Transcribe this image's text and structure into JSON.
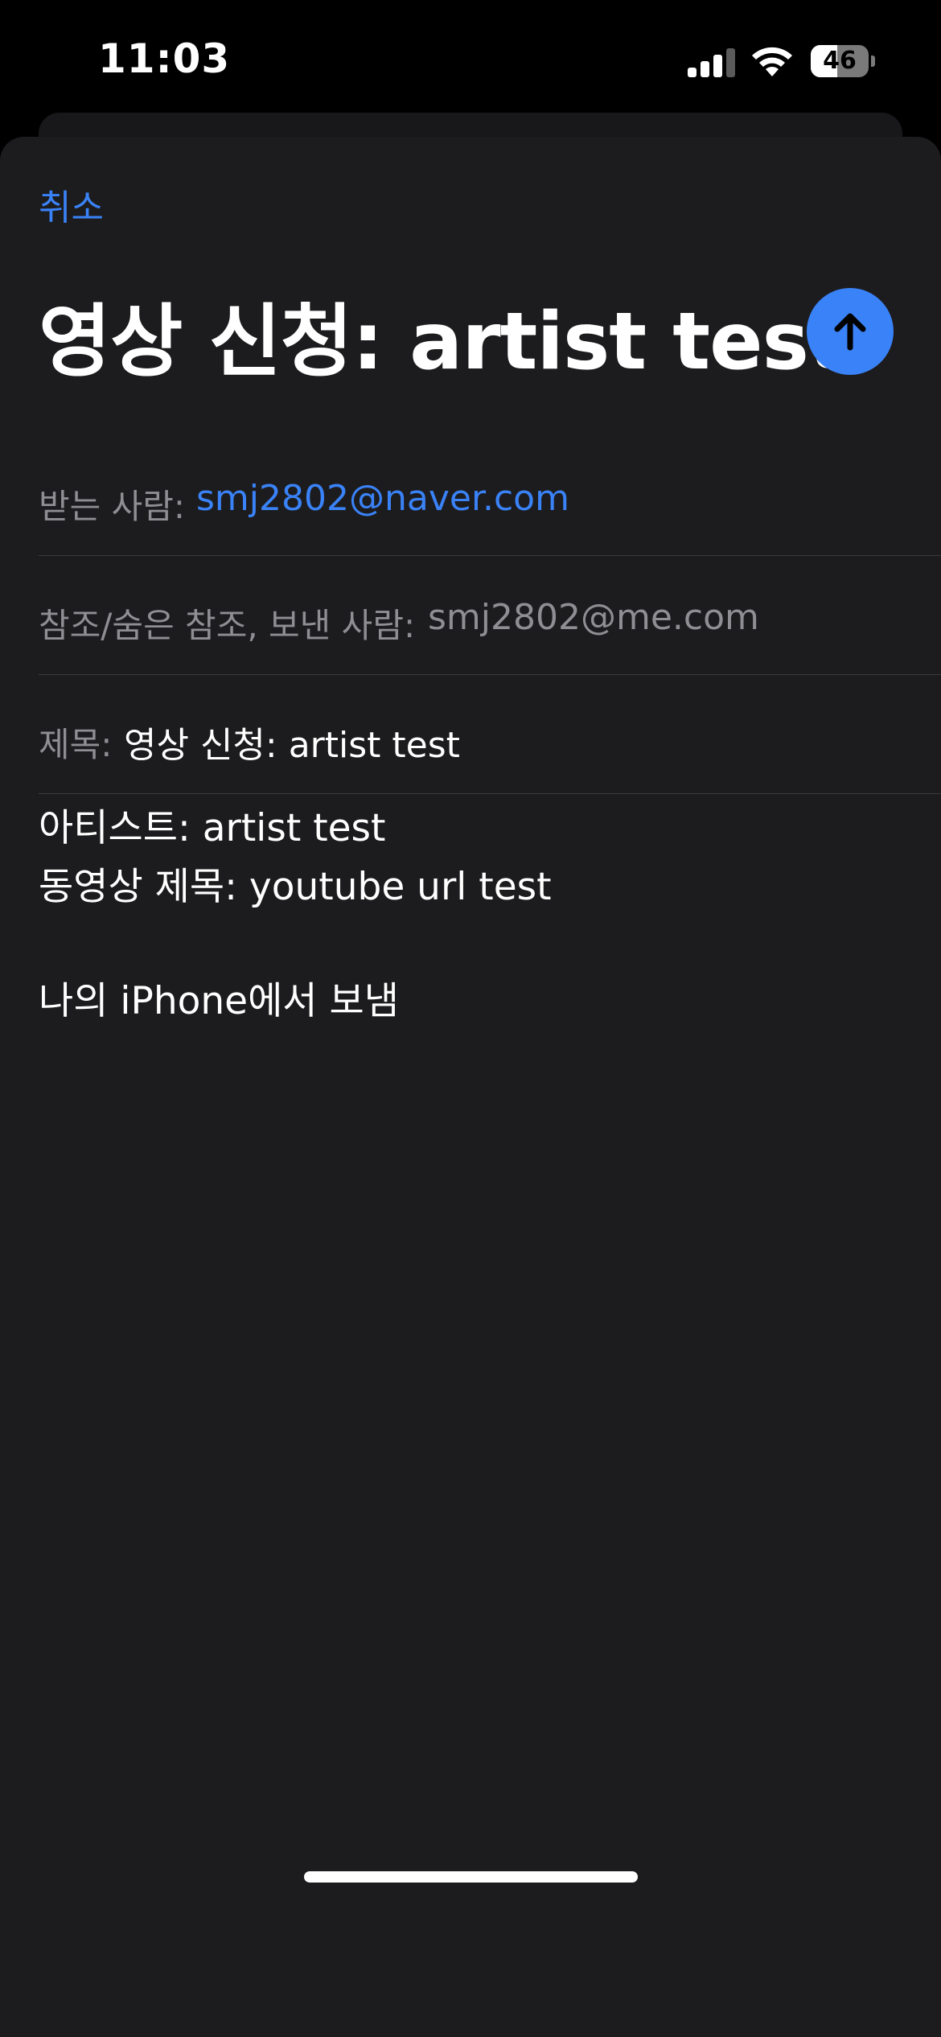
{
  "status_bar": {
    "time": "11:03",
    "battery": "46",
    "battery_fraction": 0.46
  },
  "compose": {
    "cancel_label": "취소",
    "title": "영상 신청: artist test",
    "to_label": "받는 사람:",
    "to_value": "smj2802@naver.com",
    "cc_label": "참조/숨은 참조, 보낸 사람:",
    "cc_value": "smj2802@me.com",
    "subject_label": "제목:",
    "subject_value": "영상 신청: artist test",
    "body_line1": "아티스트: artist test",
    "body_line2": "동영상 제목: youtube url test",
    "signature": "나의 iPhone에서 보냄"
  },
  "colors": {
    "accent": "#3a82f7",
    "background": "#1c1c1e",
    "secondary_text": "#8e8e93"
  },
  "icons": {
    "send": "arrow-up-icon",
    "signal": "cellular-signal-icon",
    "wifi": "wifi-icon",
    "battery": "battery-icon"
  }
}
